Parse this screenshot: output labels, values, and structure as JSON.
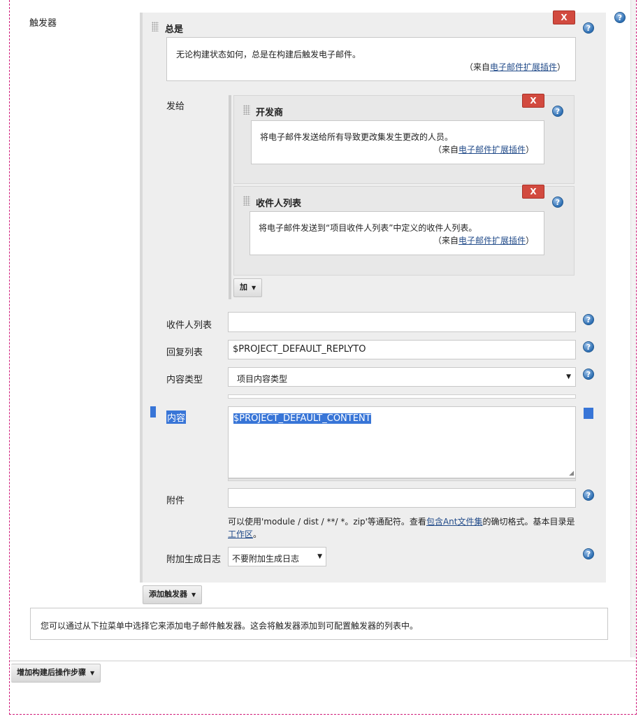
{
  "section_label": "触发器",
  "trigger": {
    "title": "总是",
    "description": "无论构建状态如何，总是在构建后触发电子邮件。",
    "source_prefix": "（来自",
    "source_link": "电子邮件扩展插件",
    "source_suffix": "）",
    "delete_label": "X"
  },
  "send_to": {
    "label": "发给",
    "recipients": [
      {
        "title": "开发商",
        "description": "将电子邮件发送给所有导致更改集发生更改的人员。",
        "source_prefix": "（来自",
        "source_link": "电子邮件扩展插件",
        "source_suffix": "）",
        "delete_label": "X"
      },
      {
        "title": "收件人列表",
        "description": "将电子邮件发送到“项目收件人列表”中定义的收件人列表。",
        "source_prefix": "（来自",
        "source_link": "电子邮件扩展插件",
        "source_suffix": "）",
        "delete_label": "X"
      }
    ],
    "add_label": "加"
  },
  "fields": {
    "recipient_list": {
      "label": "收件人列表",
      "value": ""
    },
    "reply_to": {
      "label": "回复列表",
      "value": "$PROJECT_DEFAULT_REPLYTO"
    },
    "content_type": {
      "label": "内容类型",
      "value": "项目内容类型"
    },
    "content": {
      "label": "内容",
      "value": "$PROJECT_DEFAULT_CONTENT"
    },
    "attachments": {
      "label": "附件",
      "value": "",
      "hint_1": "可以使用'module / dist / **/ *。zip'等通配符。查看",
      "hint_link_1": "包含Ant文件集",
      "hint_2": "的确切格式。基本目录是",
      "hint_link_2": "工作区",
      "hint_3": "。"
    },
    "attach_log": {
      "label": "附加生成日志",
      "value": "不要附加生成日志"
    }
  },
  "add_trigger_label": "添加触发器",
  "info_text": "您可以通过从下拉菜单中选择它来添加电子邮件触发器。这会将触发器添加到可配置触发器的列表中。",
  "add_post_build_label": "增加构建后操作步骤",
  "help_glyph": "?",
  "dropdown_glyph": "▼",
  "colors": {
    "accent_blue": "#2e6fb3",
    "delete_red": "#d24a3f",
    "panel_gray": "#eeeeee",
    "selection": "#3875d7"
  }
}
